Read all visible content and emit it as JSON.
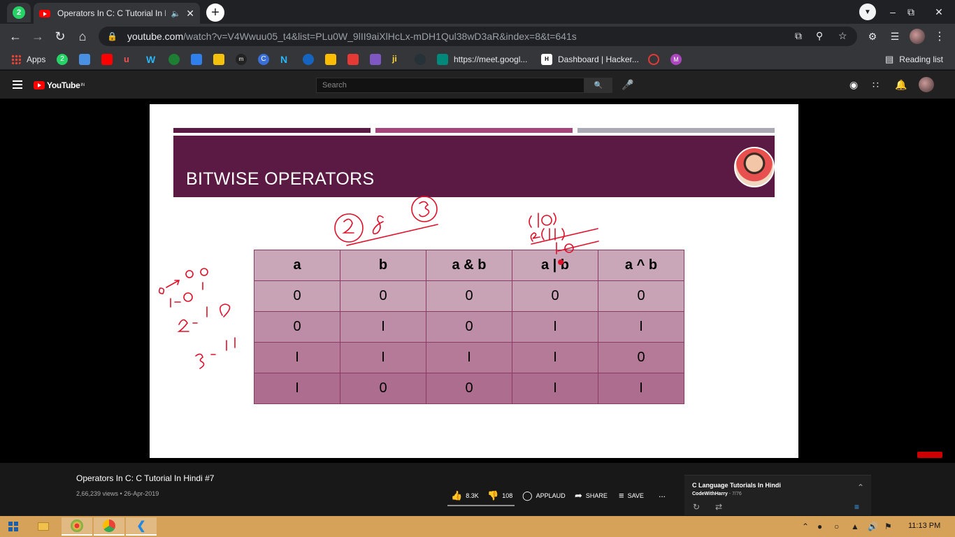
{
  "browser": {
    "whatsapp_badge": "2",
    "tab_title": "Operators In C: C Tutorial In Hindi #7",
    "audio_icon": "speaker-icon",
    "close_glyph": "✕",
    "newtab_glyph": "+",
    "url_host": "youtube.com",
    "url_path": "/watch?v=V4Wwuu05_t4&list=PLu0W_9lII9aiXlHcLx-mDH1Qul38wD3aR&index=8&t=641s"
  },
  "bookmarks": {
    "apps": "Apps",
    "wa_badge": "2",
    "meet": "https://meet.googl...",
    "hacker": "Dashboard | Hacker...",
    "hacker_badge": "H",
    "m_badge": "M",
    "reading_list": "Reading list"
  },
  "youtube": {
    "logo": "YouTube",
    "logo_region": "IN",
    "search_placeholder": "Search"
  },
  "slide": {
    "title": "BITWISE OPERATORS",
    "bar_colors": [
      "#5b1a44",
      "#a5437b",
      "#a9aab4"
    ],
    "headers": [
      "a",
      "b",
      "a & b",
      "a | b",
      "a ^ b"
    ],
    "rows": [
      [
        "0",
        "0",
        "0",
        "0",
        "0"
      ],
      [
        "0",
        "I",
        "0",
        "I",
        "I"
      ],
      [
        "I",
        "I",
        "I",
        "I",
        "0"
      ],
      [
        "I",
        "0",
        "0",
        "I",
        "I"
      ]
    ]
  },
  "video": {
    "title": "Operators In C: C Tutorial In Hindi #7",
    "meta": "2,66,239 views • 26-Apr-2019",
    "likes": "8.3K",
    "dislikes": "108",
    "applaud": "APPLAUD",
    "share": "SHARE",
    "save": "SAVE",
    "more": "..."
  },
  "playlist": {
    "title": "C Language Tutorials In Hindi",
    "channel": "CodeWithHarry",
    "position": "7/76"
  },
  "taskbar": {
    "clock": "11:13 PM"
  }
}
